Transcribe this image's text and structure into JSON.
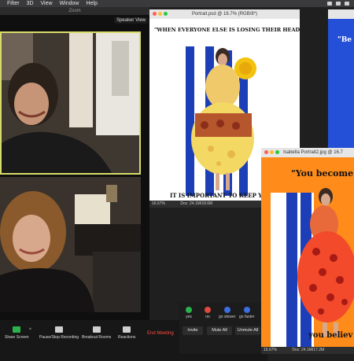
{
  "menubar": {
    "items": [
      "Filter",
      "3D",
      "View",
      "Window",
      "Help"
    ]
  },
  "zoom": {
    "window_title": "Zoom",
    "speaker_view_label": "Speaker View",
    "toolbar": [
      {
        "label": "Share Screen",
        "icon": "share-screen-icon"
      },
      {
        "label": "Pause/Stop Recording",
        "icon": "recording-icon"
      },
      {
        "label": "Breakout Rooms",
        "icon": "breakout-rooms-icon"
      },
      {
        "label": "Reactions",
        "icon": "reactions-icon"
      }
    ],
    "end_meeting_label": "End Meeting"
  },
  "participants_panel": {
    "reactions": [
      {
        "label": "yes",
        "color": "#2bb24c"
      },
      {
        "label": "no",
        "color": "#e04a3f"
      },
      {
        "label": "go slower",
        "color": "#3b6fe0"
      },
      {
        "label": "go faster",
        "color": "#3b6fe0"
      }
    ],
    "buttons": [
      "Invite",
      "Mute All",
      "Unmute All"
    ]
  },
  "photoshop_windows": [
    {
      "title": "Portrait.psd @ 16.7% (RGB/8*)",
      "quote_top": "\"WHEN EVERYONE ELSE IS LOSING THEIR HEADS,",
      "quote_bottom": "IT IS IMPORTANT TO KEEP YO",
      "zoom_level": "16.67%",
      "doc_size": "Doc: 24.1M/18.6M"
    },
    {
      "title": "Isabella Portrait2.jpg @ 16.7",
      "quote_top": "\"You become w",
      "quote_bottom": "you believ",
      "zoom_level": "16.67%",
      "doc_size": "Doc: 24.1M/17.2M"
    },
    {
      "quote_fragment": "\"Be"
    }
  ],
  "colors": {
    "speaker_border": "#d8dc6a",
    "orange_bg": "#ff8c1a",
    "blue_bg": "#2450d8",
    "end_meeting": "#ff4b40"
  }
}
